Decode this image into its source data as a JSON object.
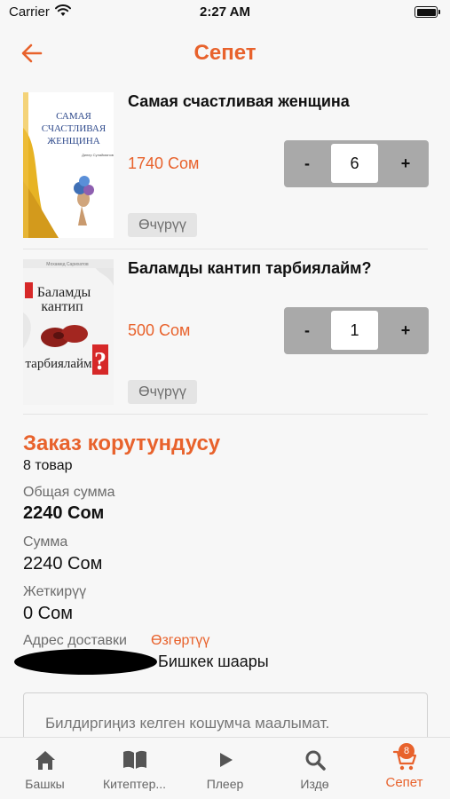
{
  "status_bar": {
    "carrier": "Carrier",
    "time": "2:27 AM"
  },
  "header": {
    "title": "Сепет"
  },
  "cart": {
    "items": [
      {
        "title": "Самая счастливая женщина",
        "price": "1740 Сом",
        "quantity": "6",
        "remove_label": "Өчүрүү",
        "cover": {
          "lines": [
            "САМАЯ",
            "СЧАСТЛИВАЯ",
            "ЖЕНЩИНА"
          ],
          "author": "Динер Сулайманов"
        }
      },
      {
        "title": "Баламды кантип тарбиялайм?",
        "price": "500 Сом",
        "quantity": "1",
        "remove_label": "Өчүрүү",
        "cover": {
          "lines": [
            "Баламды",
            "кантип",
            "тарбиялайм"
          ],
          "author": "Мохамед Сарихатов",
          "mark": "?"
        }
      }
    ],
    "minus_label": "-",
    "plus_label": "+"
  },
  "summary": {
    "title": "Заказ корутундусу",
    "item_count": "8 товар",
    "total_label": "Общая сумма",
    "total_value": "2240 Сом",
    "sum_label": "Сумма",
    "sum_value": "2240 Сом",
    "delivery_label": "Жеткирүү",
    "delivery_value": "0 Сом",
    "address_label": "Адрес доставки",
    "change_label": "Өзгөртүү",
    "address_value": "Бишкек шаары",
    "notes_placeholder": "Билдиргиңиз келген кошумча маалымат."
  },
  "tab_bar": {
    "tabs": [
      {
        "label": "Башкы",
        "icon": "home-icon"
      },
      {
        "label": "Китептер...",
        "icon": "book-icon"
      },
      {
        "label": "Плеер",
        "icon": "play-icon"
      },
      {
        "label": "Издө",
        "icon": "search-icon"
      },
      {
        "label": "Сепет",
        "icon": "cart-icon",
        "badge": "8",
        "active": true
      }
    ]
  },
  "colors": {
    "accent": "#e8622c",
    "stepper": "#a9a9a9",
    "background": "#f7f7f7"
  }
}
